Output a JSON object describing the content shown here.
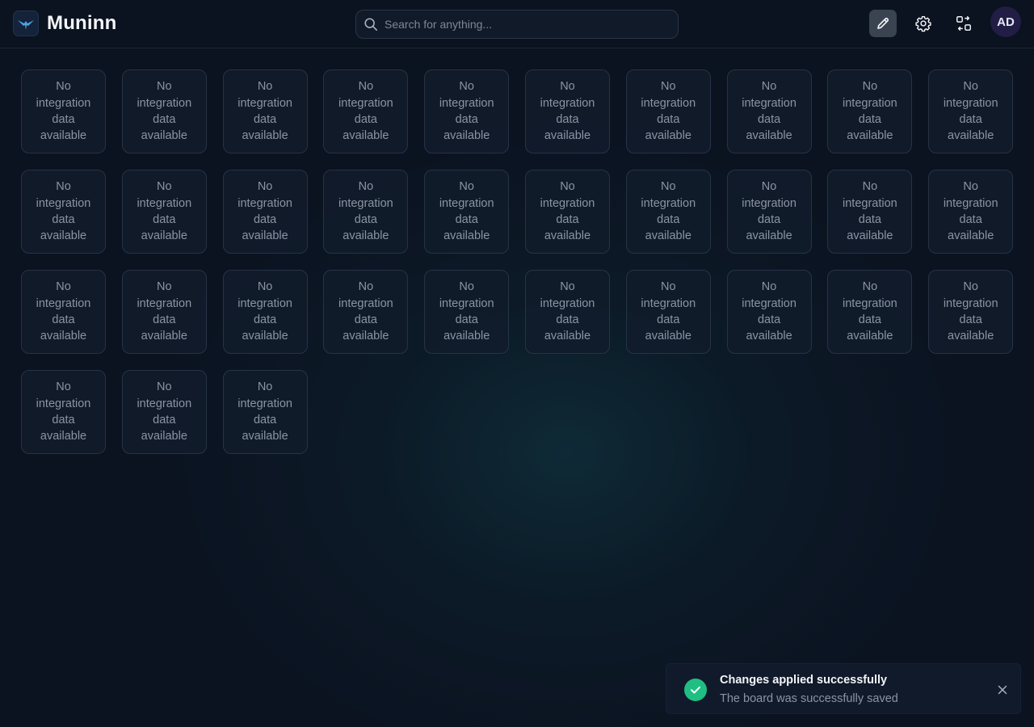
{
  "header": {
    "brand_name": "Muninn",
    "search_placeholder": "Search for anything...",
    "avatar_initials": "AD",
    "icons": [
      "muninn-logo-icon",
      "pencil-icon",
      "gear-icon",
      "switch-board-icon",
      "search-icon"
    ]
  },
  "tiles": {
    "count": 33,
    "text": "No integration data available"
  },
  "toast": {
    "title": "Changes applied successfully",
    "message": "The board was successfully saved",
    "status_color": "#1fbf84"
  }
}
